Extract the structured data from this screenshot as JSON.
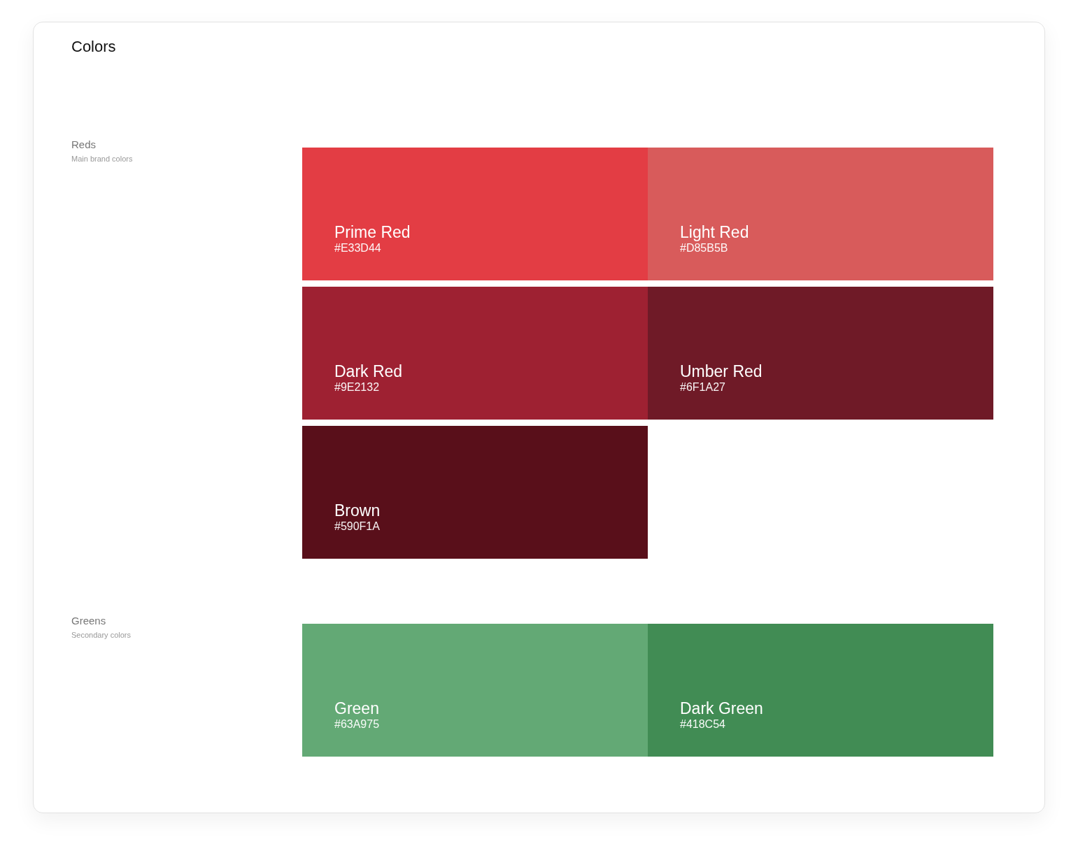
{
  "title": "Colors",
  "groups": [
    {
      "name": "Reds",
      "description": "Main brand colors",
      "swatches": [
        {
          "name": "Prime Red",
          "hex": "#E33D44",
          "color": "#e33d44"
        },
        {
          "name": "Light Red",
          "hex": "#D85B5B",
          "color": "#d85b5b"
        },
        {
          "name": "Dark Red",
          "hex": "#9E2132",
          "color": "#9e2132"
        },
        {
          "name": "Umber Red",
          "hex": "#6F1A27",
          "color": "#6f1a27"
        },
        {
          "name": "Brown",
          "hex": "#590F1A",
          "color": "#590f1a"
        }
      ]
    },
    {
      "name": "Greens",
      "description": "Secondary colors",
      "swatches": [
        {
          "name": "Green",
          "hex": "#63A975",
          "color": "#63a975"
        },
        {
          "name": "Dark Green",
          "hex": "#418C54",
          "color": "#418c54"
        }
      ]
    }
  ]
}
